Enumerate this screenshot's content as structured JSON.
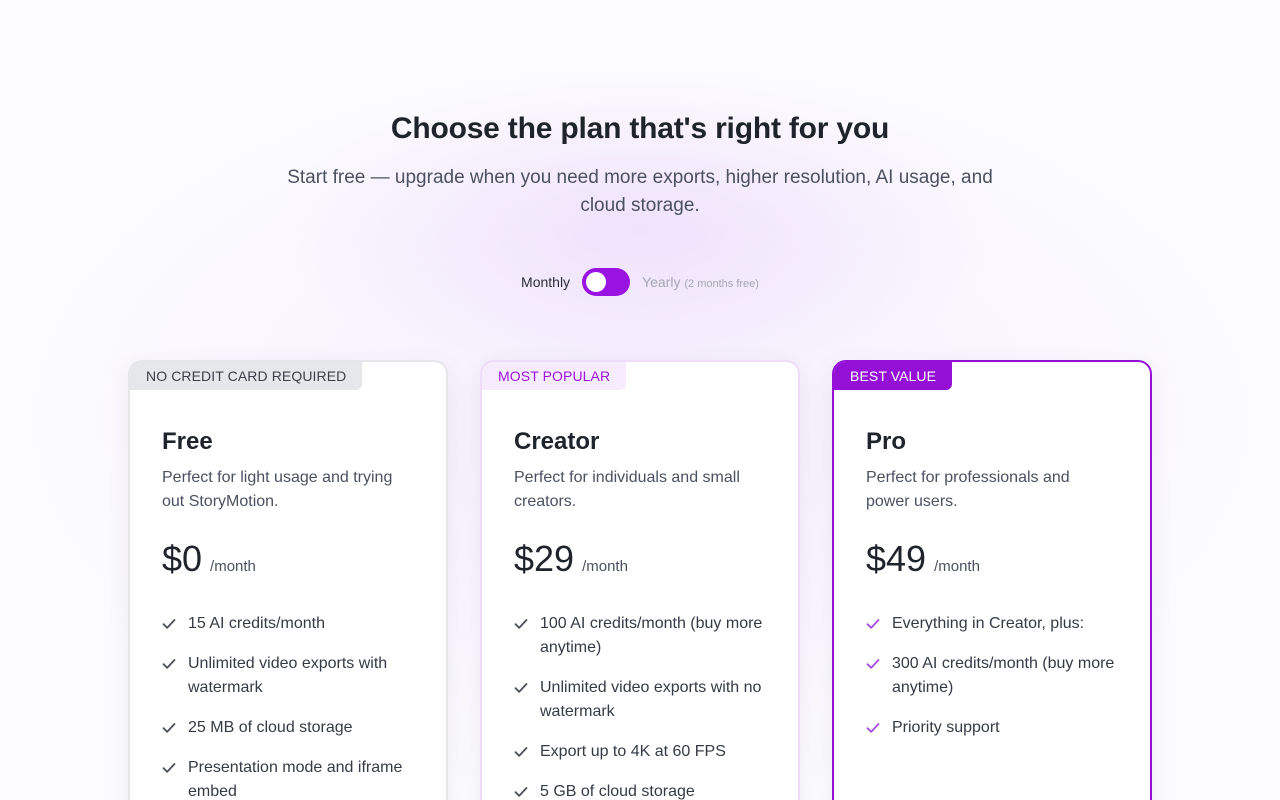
{
  "header": {
    "title": "Choose the plan that's right for you",
    "subtitle": "Start free — upgrade when you need more exports, higher resolution, AI usage, and cloud storage."
  },
  "billing_toggle": {
    "monthly_label": "Monthly",
    "yearly_label": "Yearly",
    "yearly_note": "(2 months free)",
    "selected": "Monthly",
    "accent_color": "#9b13e3"
  },
  "plans": [
    {
      "badge": "NO CREDIT CARD REQUIRED",
      "name": "Free",
      "description": "Perfect for light usage and trying out StoryMotion.",
      "price": "$0",
      "period": "/month",
      "features": [
        "15 AI credits/month",
        "Unlimited video exports with watermark",
        "25 MB of cloud storage",
        "Presentation mode and iframe embed"
      ]
    },
    {
      "badge": "MOST POPULAR",
      "name": "Creator",
      "description": "Perfect for individuals and small creators.",
      "price": "$29",
      "period": "/month",
      "features": [
        "100 AI credits/month (buy more anytime)",
        "Unlimited video exports with no watermark",
        "Export up to 4K at 60 FPS",
        "5 GB of cloud storage"
      ]
    },
    {
      "badge": "BEST VALUE",
      "name": "Pro",
      "description": "Perfect for professionals and power users.",
      "price": "$49",
      "period": "/month",
      "features": [
        "Everything in Creator, plus:",
        "300 AI credits/month (buy more anytime)",
        "Priority support"
      ],
      "accent_color": "#9410d6"
    }
  ],
  "icons": {
    "feature_bullet": "check-icon"
  }
}
